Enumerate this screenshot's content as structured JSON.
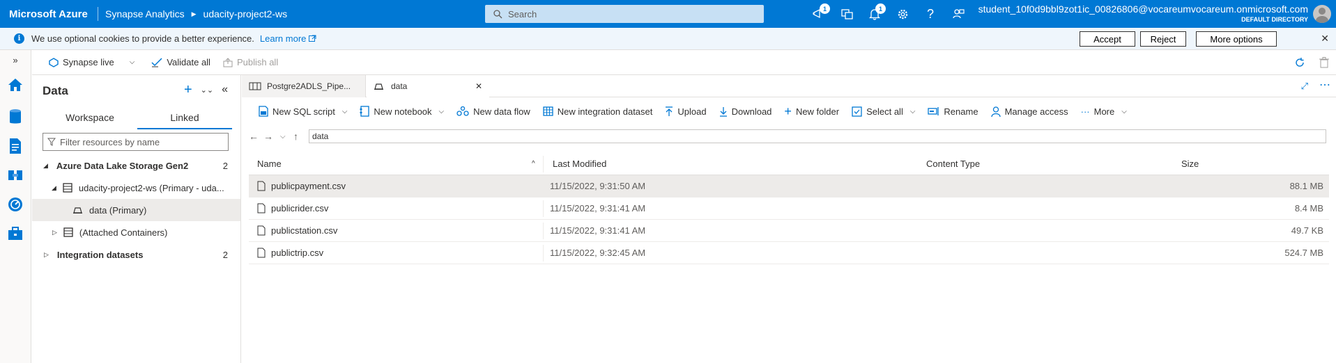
{
  "topbar": {
    "brand": "Microsoft Azure",
    "service": "Synapse Analytics",
    "workspace": "udacity-project2-ws",
    "search_placeholder": "Search",
    "notifications_badge": "1",
    "alerts_badge": "1",
    "user_name": "student_10f0d9bbl9zot1ic_00826806@vocareumvocareum.onmicrosoft.com",
    "directory": "DEFAULT DIRECTORY"
  },
  "cookie": {
    "message": "We use optional cookies to provide a better experience.",
    "learn_more": "Learn more",
    "accept": "Accept",
    "reject": "Reject",
    "more_options": "More options"
  },
  "toolbar": {
    "live": "Synapse live",
    "validate": "Validate all",
    "publish": "Publish all"
  },
  "data_panel": {
    "title": "Data",
    "tabs": [
      "Workspace",
      "Linked"
    ],
    "filter_placeholder": "Filter resources by name",
    "tree": {
      "adls": "Azure Data Lake Storage Gen2",
      "adls_count": "2",
      "workspace_node": "udacity-project2-ws (Primary - uda...",
      "data_node": "data (Primary)",
      "attached": "(Attached Containers)",
      "integration": "Integration datasets",
      "integration_count": "2"
    }
  },
  "doc_tabs": [
    "Postgre2ADLS_Pipe...",
    "data"
  ],
  "commands": {
    "new_sql": "New SQL script",
    "new_notebook": "New notebook",
    "new_dataflow": "New data flow",
    "new_integration": "New integration dataset",
    "upload": "Upload",
    "download": "Download",
    "new_folder": "New folder",
    "select_all": "Select all",
    "rename": "Rename",
    "manage_access": "Manage access",
    "more": "More"
  },
  "path": "data",
  "grid": {
    "columns": [
      "Name",
      "Last Modified",
      "Content Type",
      "Size"
    ],
    "rows": [
      {
        "name": "publicpayment.csv",
        "modified": "11/15/2022, 9:31:50 AM",
        "type": "",
        "size": "88.1 MB"
      },
      {
        "name": "publicrider.csv",
        "modified": "11/15/2022, 9:31:41 AM",
        "type": "",
        "size": "8.4 MB"
      },
      {
        "name": "publicstation.csv",
        "modified": "11/15/2022, 9:31:41 AM",
        "type": "",
        "size": "49.7 KB"
      },
      {
        "name": "publictrip.csv",
        "modified": "11/15/2022, 9:32:45 AM",
        "type": "",
        "size": "524.7 MB"
      }
    ]
  },
  "colors": {
    "accent": "#0078d4",
    "topbar": "#0078d4",
    "cookie_bg": "#eff6fc",
    "selected_row": "#edebe9"
  }
}
